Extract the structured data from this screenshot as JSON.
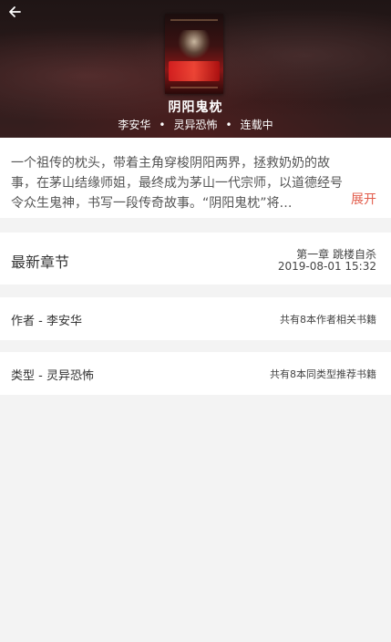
{
  "book": {
    "title": "阴阳鬼枕",
    "author": "李安华",
    "category": "灵异恐怖",
    "status": "连载中",
    "separator": "•"
  },
  "description": {
    "text": "一个祖传的枕头，带着主角穿梭阴阳两界，拯救奶奶的故事，在茅山结缘师姐，最终成为茅山一代宗师，以道德经号令众生鬼神，书写一段传奇故事。“阴阳鬼枕”将…",
    "expand_label": "展开"
  },
  "latest": {
    "label": "最新章节",
    "chapter": "第一章  跳楼自杀",
    "time": "2019-08-01 15:32"
  },
  "author_row": {
    "label": "作者 - 李安华",
    "related": "共有8本作者相关书籍"
  },
  "type_row": {
    "label": "类型 - 灵异恐怖",
    "related": "共有8本同类型推荐书籍"
  },
  "icons": {
    "back": "arrow-left-icon"
  },
  "colors": {
    "accent": "#e25b4a",
    "background": "#f3f3f3"
  }
}
